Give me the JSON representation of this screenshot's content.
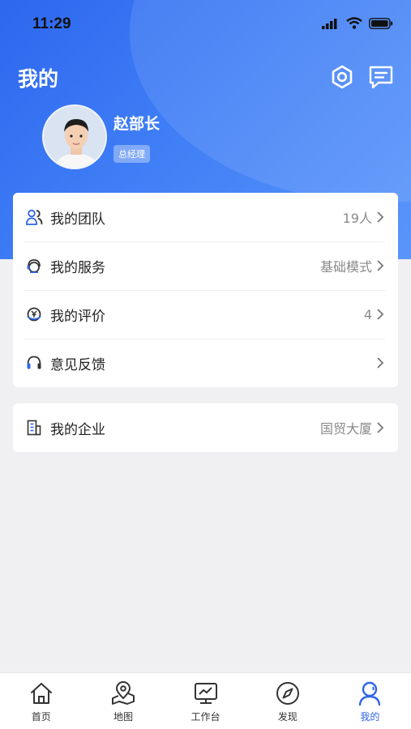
{
  "status_bar": {
    "time": "11:29"
  },
  "header": {
    "title": "我的"
  },
  "profile": {
    "name": "赵部长",
    "role": "总经理"
  },
  "menu_main": [
    {
      "label": "我的团队",
      "value": "19人",
      "icon": "team-icon"
    },
    {
      "label": "我的服务",
      "value": "基础模式",
      "icon": "service-icon"
    },
    {
      "label": "我的评价",
      "value": "4",
      "icon": "rating-icon"
    },
    {
      "label": "意见反馈",
      "value": "",
      "icon": "headset-icon"
    }
  ],
  "menu_company": [
    {
      "label": "我的企业",
      "value": "国贸大厦",
      "icon": "building-icon"
    }
  ],
  "tabs": [
    {
      "label": "首页",
      "icon": "home-icon"
    },
    {
      "label": "地图",
      "icon": "map-icon"
    },
    {
      "label": "工作台",
      "icon": "workbench-icon"
    },
    {
      "label": "发现",
      "icon": "compass-icon"
    },
    {
      "label": "我的",
      "icon": "user-icon",
      "active": true
    }
  ],
  "colors": {
    "accent": "#2f66e8",
    "hero": "#3f7ef6"
  }
}
